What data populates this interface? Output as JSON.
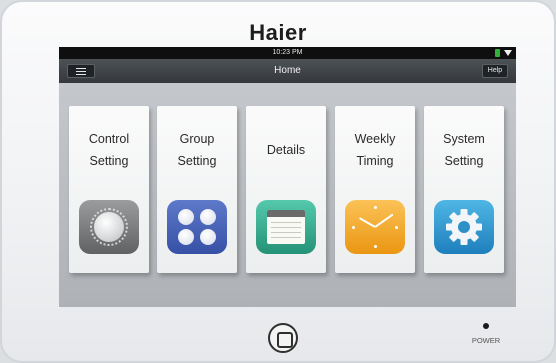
{
  "brand": "Haier",
  "status_bar": {
    "time": "10:23 PM",
    "battery_icon": "battery-icon",
    "wifi_icon": "wifi-icon"
  },
  "nav": {
    "menu_icon": "hamburger-menu-icon",
    "title": "Home",
    "help_label": "Help"
  },
  "tiles": [
    {
      "label": "Control\nSetting",
      "icon": "dial-knob-icon"
    },
    {
      "label": "Group\nSetting",
      "icon": "four-dots-icon"
    },
    {
      "label": "Details",
      "icon": "notepad-icon"
    },
    {
      "label": "Weekly\nTiming",
      "icon": "clock-icon"
    },
    {
      "label": "System\nSetting",
      "icon": "gear-icon"
    }
  ],
  "device": {
    "home_button_icon": "home-button-icon",
    "power_label": "POWER"
  },
  "colors": {
    "navbar": "#3d4146",
    "tile_bg": "#f5f6f7",
    "group_blue": "#4a63b8",
    "details_teal": "#36b092",
    "clock_orange": "#f2ab30",
    "gear_blue": "#2f9bd3"
  }
}
